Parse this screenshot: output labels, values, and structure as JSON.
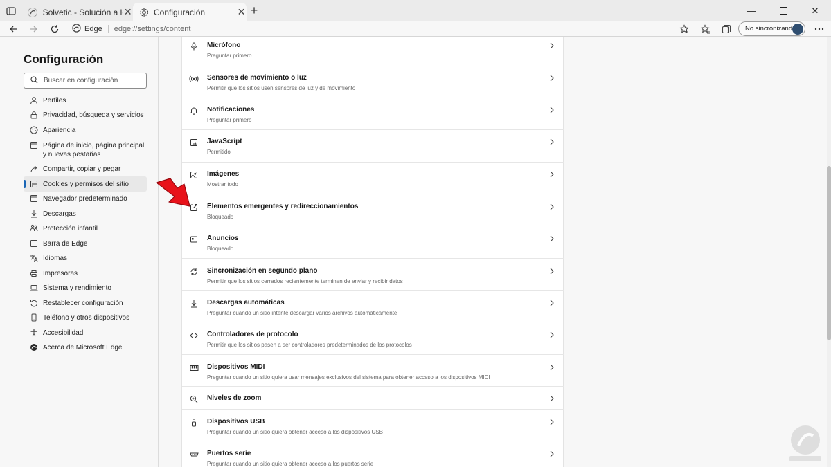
{
  "browser": {
    "tabs": [
      {
        "title": "Solvetic - Solución a los problem",
        "icon": "solvetic-favicon",
        "active": false
      },
      {
        "title": "Configuración",
        "icon": "gear-icon",
        "active": true
      }
    ],
    "address": {
      "site_label": "Edge",
      "url": "edge://settings/content"
    },
    "sync_button": {
      "label": "No sincronizando"
    }
  },
  "sidebar": {
    "title": "Configuración",
    "search_placeholder": "Buscar en configuración",
    "items": [
      {
        "label": "Perfiles",
        "icon": "profile-icon"
      },
      {
        "label": "Privacidad, búsqueda y servicios",
        "icon": "lock-icon"
      },
      {
        "label": "Apariencia",
        "icon": "appearance-icon"
      },
      {
        "label": "Página de inicio, página principal y nuevas pestañas",
        "icon": "start-page-icon"
      },
      {
        "label": "Compartir, copiar y pegar",
        "icon": "share-icon"
      },
      {
        "label": "Cookies y permisos del sitio",
        "icon": "site-permissions-icon",
        "active": true
      },
      {
        "label": "Navegador predeterminado",
        "icon": "default-browser-icon"
      },
      {
        "label": "Descargas",
        "icon": "download-icon"
      },
      {
        "label": "Protección infantil",
        "icon": "family-icon"
      },
      {
        "label": "Barra de Edge",
        "icon": "edge-bar-icon"
      },
      {
        "label": "Idiomas",
        "icon": "language-icon"
      },
      {
        "label": "Impresoras",
        "icon": "printer-icon"
      },
      {
        "label": "Sistema y rendimiento",
        "icon": "laptop-icon"
      },
      {
        "label": "Restablecer configuración",
        "icon": "reset-icon"
      },
      {
        "label": "Teléfono y otros dispositivos",
        "icon": "phone-icon"
      },
      {
        "label": "Accesibilidad",
        "icon": "accessibility-icon"
      },
      {
        "label": "Acerca de Microsoft Edge",
        "icon": "edge-logo-icon"
      }
    ]
  },
  "permissions": [
    {
      "title": "Micrófono",
      "subtitle": "Preguntar primero",
      "icon": "microphone-icon"
    },
    {
      "title": "Sensores de movimiento o luz",
      "subtitle": "Permitir que los sitios usen sensores de luz y de movimiento",
      "icon": "sensor-icon"
    },
    {
      "title": "Notificaciones",
      "subtitle": "Preguntar primero",
      "icon": "bell-icon"
    },
    {
      "title": "JavaScript",
      "subtitle": "Permitido",
      "icon": "javascript-icon"
    },
    {
      "title": "Imágenes",
      "subtitle": "Mostrar todo",
      "icon": "image-icon"
    },
    {
      "title": "Elementos emergentes y redireccionamientos",
      "subtitle": "Bloqueado",
      "icon": "popup-icon"
    },
    {
      "title": "Anuncios",
      "subtitle": "Bloqueado",
      "icon": "ads-icon"
    },
    {
      "title": "Sincronización en segundo plano",
      "subtitle": "Permitir que los sitios cerrados recientemente terminen de enviar y recibir datos",
      "icon": "sync-icon"
    },
    {
      "title": "Descargas automáticas",
      "subtitle": "Preguntar cuando un sitio intente descargar varios archivos automáticamente",
      "icon": "download-icon"
    },
    {
      "title": "Controladores de protocolo",
      "subtitle": "Permitir que los sitios pasen a ser controladores predeterminados de los protocolos",
      "icon": "protocol-icon"
    },
    {
      "title": "Dispositivos MIDI",
      "subtitle": "Preguntar cuando un sitio quiera usar mensajes exclusivos del sistema para obtener acceso a los dispositivos MIDI",
      "icon": "midi-icon"
    },
    {
      "title": "Niveles de zoom",
      "subtitle": "",
      "icon": "zoom-icon"
    },
    {
      "title": "Dispositivos USB",
      "subtitle": "Preguntar cuando un sitio quiera obtener acceso a los dispositivos USB",
      "icon": "usb-icon"
    },
    {
      "title": "Puertos serie",
      "subtitle": "Preguntar cuando un sitio quiera obtener acceso a los puertos serie",
      "icon": "serial-port-icon"
    }
  ],
  "colors": {
    "accent": "#1a66b5",
    "arrow": "#e8121a"
  }
}
